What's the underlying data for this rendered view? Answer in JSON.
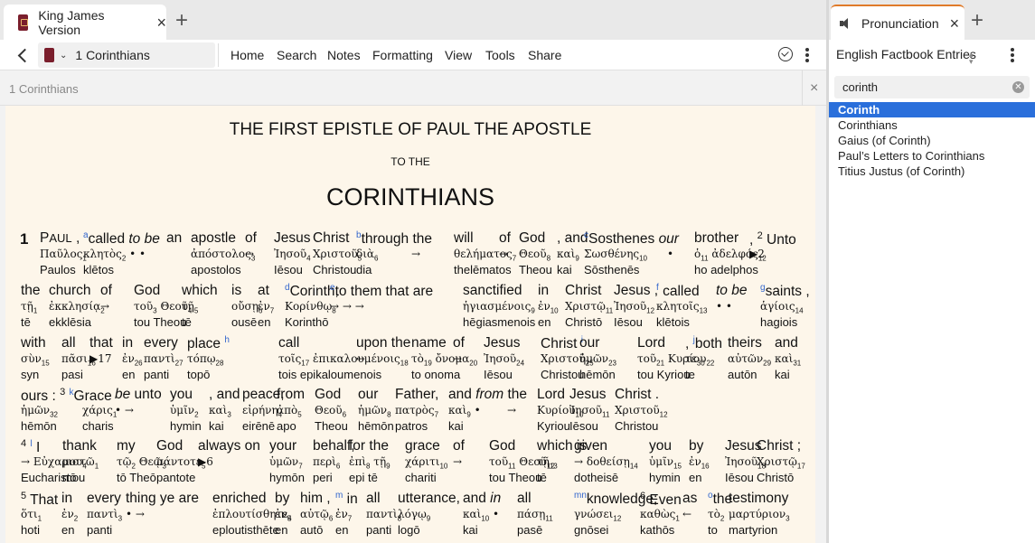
{
  "left_tabs": {
    "title": "King James Version",
    "close": "×",
    "new_tab": "+"
  },
  "toolbar": {
    "reference": "1 Corinthians",
    "menu": [
      "Home",
      "Search",
      "Notes",
      "Formatting",
      "View",
      "Tools",
      "Share"
    ]
  },
  "search": {
    "placeholder": "1 Corinthians",
    "clear": "×"
  },
  "heading": {
    "main": "THE FIRST EPISTLE OF PAUL THE APOSTLE",
    "to": "TO THE",
    "book": "CORINTHIANS"
  },
  "right_tab": {
    "title": "Pronunciation",
    "close": "×",
    "new_tab": "+"
  },
  "right_panel": {
    "title": "English Factbook Entries",
    "sort_icon": "sort-icon",
    "search_value": "corinth",
    "results": [
      "Corinth",
      "Corinthians",
      "Gaius (of Corinth)",
      "Paul’s Letters to Corinthians",
      "Titius Justus (of Corinth)"
    ],
    "selected_index": 0
  },
  "lines": [
    [
      {
        "en": "<b style='font-size:17px'>1</b>",
        "gk": "",
        "tr": ""
      },
      {
        "en": "P<span style='font-size:13px'>AUL</span> ,",
        "gk": "Παῦλος<sub>1</sub>",
        "tr": "Paulos"
      },
      {
        "en": "<sup class='fn'>a</sup>called <i>to be</i>",
        "gk": "κλητὸς<sub>2</sub>  •  •",
        "tr": "klētos"
      },
      {
        "en": "an",
        "gk": "",
        "tr": ""
      },
      {
        "en": "apostle",
        "gk": "ἀπόστολος<sub>3</sub>",
        "tr": "apostolos"
      },
      {
        "en": "of",
        "gk": "→",
        "tr": ""
      },
      {
        "en": "Jesus",
        "gk": "Ἰησοῦ<sub>4</sub>",
        "tr": "Iēsou"
      },
      {
        "en": "Christ",
        "gk": "Χριστοῦ<sub>5</sub>",
        "tr": "Christou"
      },
      {
        "en": "<sup class='fn'>b</sup>through the",
        "gk": "διὰ<sub>6</sub>",
        "tr": "dia"
      },
      {
        "en": "",
        "gk": "→",
        "tr": ""
      },
      {
        "en": "will",
        "gk": "θελήματος<sub>7</sub>",
        "tr": "thelēmatos"
      },
      {
        "en": "of",
        "gk": "→",
        "tr": ""
      },
      {
        "en": "God",
        "gk": "Θεοῦ<sub>8</sub>",
        "tr": "Theou"
      },
      {
        "en": ", and",
        "gk": "καὶ<sub>9</sub>",
        "tr": "kai"
      },
      {
        "en": "<sup class='fn'>c</sup>Sosthenes <i>our</i>",
        "gk": "Σωσθένης<sub>10</sub>",
        "tr": "Sōsthenēs"
      },
      {
        "en": "",
        "gk": "•",
        "tr": ""
      },
      {
        "en": "brother",
        "gk": "ὁ<sub>11</sub> ἀδελφός<sub>12</sub>",
        "tr": "ho adelphos"
      },
      {
        "en": ", <sup class='vn'>2</sup> Unto",
        "gk": "▶2",
        "tr": ""
      }
    ],
    [
      {
        "en": "the",
        "gk": "τῇ<sub>1</sub>",
        "tr": "tē"
      },
      {
        "en": "church",
        "gk": "ἐκκλησίᾳ<sub>2</sub>",
        "tr": "ekklēsia"
      },
      {
        "en": "of",
        "gk": "→",
        "tr": ""
      },
      {
        "en": "God",
        "gk": "τοῦ<sub>3</sub> Θεοῦ<sub>4</sub>",
        "tr": "tou Theou"
      },
      {
        "en": "which",
        "gk": "τῇ<sub>5</sub>",
        "tr": "tē"
      },
      {
        "en": "is",
        "gk": "οὔσῃ<sub>6</sub>",
        "tr": "ousē"
      },
      {
        "en": "at",
        "gk": "ἐν<sub>7</sub>",
        "tr": "en"
      },
      {
        "en": "<sup class='fn'>d</sup>Corinth,",
        "gk": "Κορίνθῳ<sub>8</sub>",
        "tr": "Korinthō"
      },
      {
        "en": "<sup class='fn'>e</sup>to them that are",
        "gk": "→      →      →",
        "tr": ""
      },
      {
        "en": "sanctified",
        "gk": "ἡγιασμένοις<sub>9</sub>",
        "tr": "hēgiasmenois"
      },
      {
        "en": "in",
        "gk": "ἐν<sub>10</sub>",
        "tr": "en"
      },
      {
        "en": "Christ",
        "gk": "Χριστῷ<sub>11</sub>",
        "tr": "Christō"
      },
      {
        "en": "Jesus ,",
        "gk": "Ἰησοῦ<sub>12</sub>",
        "tr": "Iēsou"
      },
      {
        "en": "<sup class='fn'>f</sup> called",
        "gk": "κλητοῖς<sub>13</sub>",
        "tr": "klētois"
      },
      {
        "en": "<i>to be</i>",
        "gk": "•   •",
        "tr": ""
      },
      {
        "en": "<sup class='fn'>g</sup>saints ,",
        "gk": "ἁγίοις<sub>14</sub>",
        "tr": "hagiois"
      }
    ],
    [
      {
        "en": "with",
        "gk": "σὺν<sub>15</sub>",
        "tr": "syn"
      },
      {
        "en": "all",
        "gk": "πᾶσι<sub>16</sub>",
        "tr": "pasi"
      },
      {
        "en": "that",
        "gk": "▶17",
        "tr": ""
      },
      {
        "en": "in",
        "gk": "ἐν<sub>26</sub>",
        "tr": "en"
      },
      {
        "en": "every",
        "gk": "παντὶ<sub>27</sub>",
        "tr": "panti"
      },
      {
        "en": "place <sup class='fn'>h</sup>",
        "gk": "τόπῳ<sub>28</sub>",
        "tr": "topō"
      },
      {
        "en": "call",
        "gk": "τοῖς<sub>17</sub> ἐπικαλουμένοις<sub>18</sub>",
        "tr": "tois epikaloumenois"
      },
      {
        "en": "upon the",
        "gk": "←",
        "tr": ""
      },
      {
        "en": "name",
        "gk": "τὸ<sub>19</sub> ὄνομα<sub>20</sub>",
        "tr": "to  onoma"
      },
      {
        "en": "of",
        "gk": "→",
        "tr": ""
      },
      {
        "en": "Jesus",
        "gk": "Ἰησοῦ<sub>24</sub>",
        "tr": "Iēsou"
      },
      {
        "en": "Christ <sup class='fn'>i</sup>",
        "gk": "Χριστοῦ<sub>25</sub>",
        "tr": "Christou"
      },
      {
        "en": "our",
        "gk": "ἡμῶν<sub>23</sub>",
        "tr": "hēmōn"
      },
      {
        "en": "Lord",
        "gk": "τοῦ<sub>21</sub> Κυρίου<sub>22</sub>",
        "tr": "tou Kyriou"
      },
      {
        "en": ", <sup class='fn'>j</sup>both",
        "gk": "τε<sub>30</sub>",
        "tr": "te"
      },
      {
        "en": "theirs",
        "gk": "αὐτῶν<sub>29</sub>",
        "tr": "autōn"
      },
      {
        "en": "and",
        "gk": "καὶ<sub>31</sub>",
        "tr": "kai"
      }
    ],
    [
      {
        "en": "ours : <sup class='vn'>3</sup> <sup class='fn'>k</sup>Grace",
        "gk": "ἡμῶν<sub>32</sub>",
        "tr": "hēmōn"
      },
      {
        "en": "",
        "gk": "χάρις<sub>1</sub>",
        "tr": "charis"
      },
      {
        "en": "<i>be</i> unto",
        "gk": "•     →",
        "tr": ""
      },
      {
        "en": "you",
        "gk": "ὑμῖν<sub>2</sub>",
        "tr": "hymin"
      },
      {
        "en": ", and",
        "gk": "καὶ<sub>3</sub>",
        "tr": "kai"
      },
      {
        "en": "peace,",
        "gk": "εἰρήνη<sub>4</sub>",
        "tr": "eirēnē"
      },
      {
        "en": "from",
        "gk": "ἀπὸ<sub>5</sub>",
        "tr": "apo"
      },
      {
        "en": "God",
        "gk": "Θεοῦ<sub>6</sub>",
        "tr": "Theou"
      },
      {
        "en": "our",
        "gk": "ἡμῶν<sub>8</sub>",
        "tr": "hēmōn"
      },
      {
        "en": "Father,",
        "gk": "πατρὸς<sub>7</sub>",
        "tr": "patros"
      },
      {
        "en": "and <i>from</i> the",
        "gk": "καὶ<sub>9</sub>      •",
        "tr": "kai"
      },
      {
        "en": "",
        "gk": "→",
        "tr": ""
      },
      {
        "en": "Lord",
        "gk": "Κυρίου<sub>10</sub>",
        "tr": "Kyriou"
      },
      {
        "en": "Jesus",
        "gk": "Ἰησοῦ<sub>11</sub>",
        "tr": "Iēsou"
      },
      {
        "en": "Christ .",
        "gk": "Χριστοῦ<sub>12</sub>",
        "tr": "Christou"
      }
    ],
    [
      {
        "en": "<sup class='vn'>4</sup> <sup class='fn'>l</sup> I",
        "gk": "→ Εὐχαριστῶ<sub>1</sub>",
        "tr": "Eucharistō"
      },
      {
        "en": "thank",
        "gk": "μου<sub>4</sub>",
        "tr": "mou"
      },
      {
        "en": "my",
        "gk": "τῷ<sub>2</sub> Θεῷ<sub>3</sub>",
        "tr": "tō Theō"
      },
      {
        "en": "God",
        "gk": "πάντοτε<sub>5</sub>",
        "tr": "pantote"
      },
      {
        "en": "always on",
        "gk": "▶6",
        "tr": ""
      },
      {
        "en": "your",
        "gk": "ὑμῶν<sub>7</sub>",
        "tr": "hymōn"
      },
      {
        "en": "behalf,",
        "gk": "περὶ<sub>6</sub>",
        "tr": "peri"
      },
      {
        "en": "for the",
        "gk": "ἐπὶ<sub>8</sub> τῇ<sub>9</sub>",
        "tr": "epi   tē"
      },
      {
        "en": "grace",
        "gk": "χάριτι<sub>10</sub>",
        "tr": "chariti"
      },
      {
        "en": "of",
        "gk": "→",
        "tr": ""
      },
      {
        "en": "God",
        "gk": "τοῦ<sub>11</sub> Θεοῦ<sub>12</sub>",
        "tr": "tou Theou"
      },
      {
        "en": "which is",
        "gk": "τῇ<sub>13</sub>",
        "tr": "tē"
      },
      {
        "en": "given",
        "gk": "→ δοθείσῃ<sub>14</sub>",
        "tr": "dotheisē"
      },
      {
        "en": "you",
        "gk": "ὑμῖν<sub>15</sub>",
        "tr": "hymin"
      },
      {
        "en": "by",
        "gk": "ἐν<sub>16</sub>",
        "tr": "en"
      },
      {
        "en": "Jesus",
        "gk": "Ἰησοῦ<sub>18</sub>",
        "tr": "Iēsou"
      },
      {
        "en": "Christ ;",
        "gk": "Χριστῷ<sub>17</sub>",
        "tr": "Christō"
      }
    ],
    [
      {
        "en": "<sup class='vn'>5</sup> That",
        "gk": "ὅτι<sub>1</sub>",
        "tr": "hoti"
      },
      {
        "en": "in",
        "gk": "ἐν<sub>2</sub>",
        "tr": "en"
      },
      {
        "en": "every",
        "gk": "παντὶ<sub>3</sub>",
        "tr": "panti"
      },
      {
        "en": "thing ye are",
        "gk": "•        →",
        "tr": ""
      },
      {
        "en": "enriched",
        "gk": "ἐπλουτίσθητε<sub>4</sub>",
        "tr": "eploutisthēte"
      },
      {
        "en": "by",
        "gk": "ἐν<sub>5</sub>",
        "tr": "en"
      },
      {
        "en": "him ,",
        "gk": "αὐτῷ<sub>6</sub>",
        "tr": "autō"
      },
      {
        "en": "<sup class='fn'>m</sup> in",
        "gk": "ἐν<sub>7</sub>",
        "tr": "en"
      },
      {
        "en": "all",
        "gk": "παντὶ<sub>8</sub>",
        "tr": "panti"
      },
      {
        "en": "utterance,",
        "gk": "λόγῳ<sub>9</sub>",
        "tr": "logō"
      },
      {
        "en": "and <i>in</i>",
        "gk": "καὶ<sub>10</sub>  •",
        "tr": "kai"
      },
      {
        "en": "all",
        "gk": "πάσῃ<sub>11</sub>",
        "tr": "pasē"
      },
      {
        "en": "<sup class='fn'>mn</sup>knowledge;",
        "gk": "γνώσει<sub>12</sub>",
        "tr": "gnōsei"
      },
      {
        "en": "<sup class='vn'>6</sup> Even",
        "gk": "καθὼς<sub>1</sub>",
        "tr": "kathōs"
      },
      {
        "en": "as",
        "gk": "←",
        "tr": ""
      },
      {
        "en": "<sup class='fn'>o</sup>the",
        "gk": "τὸ<sub>2</sub>",
        "tr": "to"
      },
      {
        "en": "testimony",
        "gk": "μαρτύριον<sub>3</sub>",
        "tr": "martyrion"
      }
    ]
  ]
}
